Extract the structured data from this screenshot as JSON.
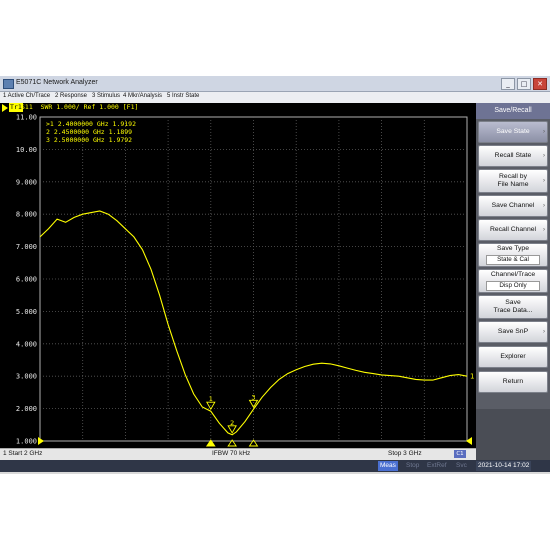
{
  "window": {
    "title": "E5071C Network Analyzer",
    "minimize": "_",
    "maximize": "□",
    "close": "✕"
  },
  "menu": [
    "1 Active Ch/Trace",
    "2 Response",
    "3 Stimulus",
    "4 Mkr/Analysis",
    "5 Instr State"
  ],
  "trace": {
    "badge": "Tr1",
    "header": "S11  SWR 1.000/ Ref 1.000 [F1]",
    "color": "#ffff00"
  },
  "markers": {
    "lines": [
      ">1   2.4000000 GHz  1.9192",
      " 2   2.4500000 GHz  1.1899",
      " 3   2.5000000 GHz  1.9792"
    ]
  },
  "chart_data": {
    "type": "line",
    "title": "",
    "xlabel": "",
    "ylabel": "",
    "xlim": [
      2,
      3
    ],
    "ylim": [
      1,
      11
    ],
    "y_tick_labels": [
      "11.00",
      "10.00",
      "9.000",
      "8.000",
      "7.000",
      "6.000",
      "5.000",
      "4.000",
      "3.000",
      "2.000",
      "1.000"
    ],
    "grid": true,
    "series": [
      {
        "name": "S11 SWR",
        "x": [
          2.0,
          2.02,
          2.04,
          2.06,
          2.08,
          2.1,
          2.12,
          2.14,
          2.16,
          2.18,
          2.2,
          2.22,
          2.24,
          2.26,
          2.28,
          2.3,
          2.32,
          2.34,
          2.36,
          2.38,
          2.4,
          2.42,
          2.44,
          2.45,
          2.46,
          2.48,
          2.5,
          2.52,
          2.54,
          2.56,
          2.58,
          2.6,
          2.62,
          2.64,
          2.66,
          2.68,
          2.7,
          2.72,
          2.74,
          2.76,
          2.78,
          2.8,
          2.82,
          2.84,
          2.86,
          2.88,
          2.9,
          2.92,
          2.94,
          2.96,
          2.98,
          3.0
        ],
        "y": [
          7.3,
          7.55,
          7.85,
          7.75,
          7.9,
          8.0,
          8.05,
          8.1,
          8.0,
          7.8,
          7.55,
          7.3,
          6.9,
          6.3,
          5.5,
          4.6,
          3.8,
          3.05,
          2.45,
          2.05,
          1.92,
          1.55,
          1.25,
          1.19,
          1.28,
          1.6,
          1.98,
          2.35,
          2.65,
          2.9,
          3.08,
          3.2,
          3.3,
          3.37,
          3.4,
          3.38,
          3.32,
          3.25,
          3.18,
          3.12,
          3.08,
          3.04,
          3.02,
          3.0,
          2.95,
          2.9,
          2.88,
          2.88,
          2.95,
          3.02,
          3.05,
          3.0
        ]
      }
    ],
    "marker_points": [
      {
        "id": "1",
        "x": 2.4,
        "y": 1.9192
      },
      {
        "id": "2",
        "x": 2.45,
        "y": 1.1899
      },
      {
        "id": "3",
        "x": 2.5,
        "y": 1.9792
      }
    ],
    "ref_marker_label": "1"
  },
  "stimulus": {
    "start": "1  Start 2 GHz",
    "ifbw": "IFBW 70 kHz",
    "stop": "Stop 3 GHz",
    "channel": "C1"
  },
  "status": {
    "meas": "Meas",
    "items": [
      "Stop",
      "ExtRef",
      "Svc"
    ],
    "datetime": "2021-10-14 17:02"
  },
  "softkeys": {
    "header": "Save/Recall",
    "items": [
      {
        "label": "Save State",
        "arrow": "›",
        "active": true
      },
      {
        "label": "Recall State",
        "arrow": "›"
      },
      {
        "label": "Recall by",
        "label2": "File Name",
        "arrow": "›"
      },
      {
        "label": "Save Channel",
        "arrow": "›"
      },
      {
        "label": "Recall Channel",
        "arrow": "›"
      },
      {
        "label": "Save Type",
        "value": "State & Cal"
      },
      {
        "label": "Channel/Trace",
        "value": "Disp Only"
      },
      {
        "label": "Save",
        "label2": "Trace Data..."
      },
      {
        "label": "Save SnP",
        "arrow": "›"
      },
      {
        "label": "Explorer"
      },
      {
        "label": "Return"
      }
    ]
  }
}
